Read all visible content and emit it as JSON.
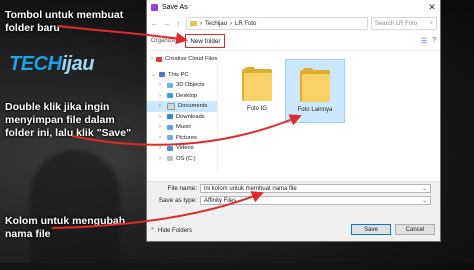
{
  "logo": {
    "part1": "TECH",
    "part2": "ijau"
  },
  "annotations": {
    "new_folder_tip": "Tombol untuk membuat folder baru",
    "double_click_tip": "Double klik jika ingin menyimpan file dalam folder ini, lalu klik \"Save\"",
    "file_name_tip": "Kolom untuk mengubah nama file"
  },
  "colors": {
    "annotation_box": "#e12a2a",
    "logo_blue": "#1ba3e8",
    "selection": "#cce8ff"
  },
  "dialog": {
    "title": "Save As",
    "close_icon": "close-icon",
    "breadcrumb": [
      "Techijau",
      "LR Foto"
    ],
    "search_placeholder": "Search LR Foto",
    "toolbar": {
      "organize": "Organize",
      "new_folder": "New folder"
    },
    "sidebar": [
      {
        "label": "Creative Cloud Files",
        "icon": "cloud-icon",
        "level": 0
      },
      {
        "label": "This PC",
        "icon": "pc-icon",
        "level": 0
      },
      {
        "label": "3D Objects",
        "icon": "3d-objects-icon",
        "level": 1
      },
      {
        "label": "Desktop",
        "icon": "desktop-icon",
        "level": 1
      },
      {
        "label": "Documents",
        "icon": "documents-icon",
        "level": 1
      },
      {
        "label": "Downloads",
        "icon": "downloads-icon",
        "level": 1
      },
      {
        "label": "Music",
        "icon": "music-icon",
        "level": 1
      },
      {
        "label": "Pictures",
        "icon": "pictures-icon",
        "level": 1
      },
      {
        "label": "Videos",
        "icon": "videos-icon",
        "level": 1
      },
      {
        "label": "OS (C:)",
        "icon": "drive-icon",
        "level": 1
      }
    ],
    "folders": [
      {
        "label": "Foto IG",
        "selected": false
      },
      {
        "label": "Foto Lainnya",
        "selected": true
      }
    ],
    "file_name_label": "File name:",
    "file_name_value": "ini kolom untuk membuat nama file",
    "save_as_type_label": "Save as type:",
    "save_as_type_value": "Affinity Files",
    "hide_folders": "Hide Folders",
    "save_button": "Save",
    "cancel_button": "Cancel"
  }
}
